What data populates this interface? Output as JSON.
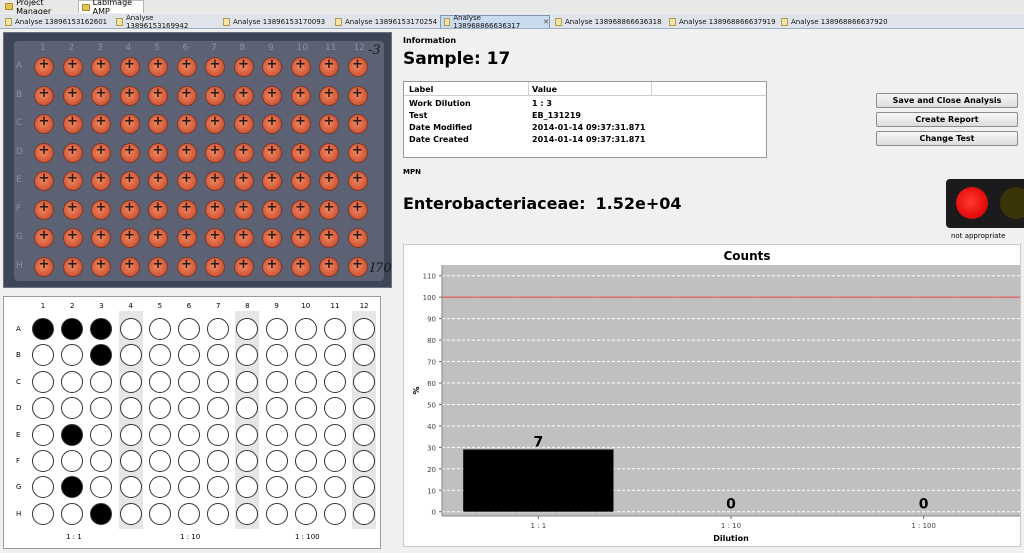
{
  "topbar": {
    "tabs": [
      {
        "label": "Project Manager"
      },
      {
        "label": "LabImage AMP"
      }
    ]
  },
  "analyse_tabs": [
    {
      "label": "Analyse 13896153162601",
      "active": false
    },
    {
      "label": "Analyse 13896153169942",
      "active": false
    },
    {
      "label": "Analyse 13896153170093",
      "active": false
    },
    {
      "label": "Analyse 13896153170254",
      "active": false
    },
    {
      "label": "Analyse 138968866636317",
      "active": true
    },
    {
      "label": "Analyse 138968866636318",
      "active": false
    },
    {
      "label": "Analyse 138968866637919",
      "active": false
    },
    {
      "label": "Analyse 138968866637920",
      "active": false
    }
  ],
  "photo": {
    "col_labels": [
      "1",
      "2",
      "3",
      "4",
      "5",
      "6",
      "7",
      "8",
      "9",
      "10",
      "11",
      "12"
    ],
    "row_labels": [
      "A",
      "B",
      "C",
      "D",
      "E",
      "F",
      "G",
      "H"
    ],
    "mark_top_right": "-3",
    "mark_bottom_right": "I70"
  },
  "plate": {
    "col_labels": [
      "1",
      "2",
      "3",
      "4",
      "5",
      "6",
      "7",
      "8",
      "9",
      "10",
      "11",
      "12"
    ],
    "row_labels": [
      "A",
      "B",
      "C",
      "D",
      "E",
      "F",
      "G",
      "H"
    ],
    "positive_wells": [
      "A1",
      "A2",
      "A3",
      "B3",
      "E2",
      "G2",
      "H3"
    ],
    "dilution_labels": [
      "1 : 1",
      "1 : 10",
      "1 : 100"
    ]
  },
  "info": {
    "section_label": "Information",
    "title": "Sample: 17",
    "table_headers": [
      "Label",
      "Value"
    ],
    "rows": [
      {
        "label": "Work Dilution",
        "value": "1 : 3"
      },
      {
        "label": "Test",
        "value": "EB_131219"
      },
      {
        "label": "Date Modified",
        "value": "2014-01-14 09:37:31.871"
      },
      {
        "label": "Date Created",
        "value": "2014-01-14 09:37:31.871"
      }
    ]
  },
  "buttons": {
    "save_close": "Save and Close Analysis",
    "create_report": "Create Report",
    "change_test": "Change Test"
  },
  "mpn": {
    "section_label": "MPN",
    "organism": "Enterobacteriaceae:",
    "value": "1.52e+04",
    "status_text": "not appropriate",
    "status_color": "#e60f0f"
  },
  "chart_data": {
    "type": "bar",
    "title": "Counts",
    "xlabel": "Dilution",
    "ylabel": "%",
    "categories": [
      "1 : 1",
      "1 : 10",
      "1 : 100"
    ],
    "values": [
      29,
      0,
      0
    ],
    "data_labels": [
      "7",
      "0",
      "0"
    ],
    "ylim": [
      -2,
      115
    ],
    "yticks": [
      0,
      10,
      20,
      30,
      40,
      50,
      60,
      70,
      80,
      90,
      100,
      110
    ],
    "reference_line": 100,
    "reference_line_color": "#e04040",
    "bar_color": "#000000",
    "plot_background": "#c0c0c0",
    "grid": true
  }
}
